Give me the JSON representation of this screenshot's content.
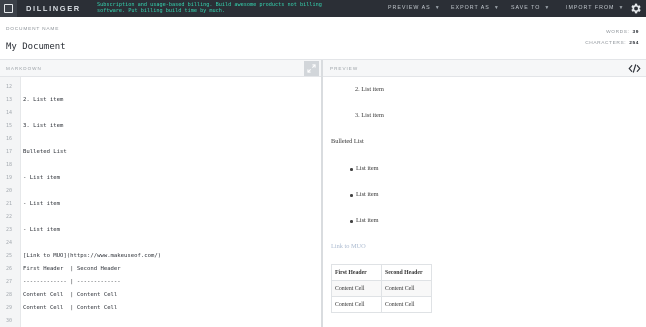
{
  "app": {
    "brand": "DILLINGER",
    "promo_line1": "Subscription and usage-based billing. Build awesome products not billing",
    "promo_line2": "software. Put billing build time by much.",
    "menu": [
      {
        "label": "PREVIEW AS"
      },
      {
        "label": "EXPORT AS"
      },
      {
        "label": "SAVE TO"
      },
      {
        "label": "IMPORT FROM"
      }
    ]
  },
  "document": {
    "name_label": "DOCUMENT NAME",
    "name": "My Document",
    "words_label": "WORDS:",
    "words": "39",
    "characters_label": "CHARACTERS:",
    "characters": "254"
  },
  "panes": {
    "editor_title": "MARKDOWN",
    "preview_title": "PREVIEW"
  },
  "editor_lines": [
    {
      "n": "12",
      "text": ""
    },
    {
      "n": "13",
      "text": "2. List item"
    },
    {
      "n": "14",
      "text": ""
    },
    {
      "n": "15",
      "text": "3. List item"
    },
    {
      "n": "16",
      "text": ""
    },
    {
      "n": "17",
      "text": "Bulleted List"
    },
    {
      "n": "18",
      "text": ""
    },
    {
      "n": "19",
      "text": "- List item"
    },
    {
      "n": "20",
      "text": ""
    },
    {
      "n": "21",
      "text": "- List item"
    },
    {
      "n": "22",
      "text": ""
    },
    {
      "n": "23",
      "text": "- List item"
    },
    {
      "n": "24",
      "text": ""
    },
    {
      "n": "25",
      "text": "[Link to MUO](https://www.makeuseof.com/)"
    },
    {
      "n": "26",
      "text": "First Header  | Second Header"
    },
    {
      "n": "27",
      "text": "------------- | -------------"
    },
    {
      "n": "28",
      "text": "Content Cell  | Content Cell"
    },
    {
      "n": "29",
      "text": "Content Cell  | Content Cell"
    },
    {
      "n": "30",
      "text": ""
    }
  ],
  "preview": {
    "ordered": [
      "2. List item",
      "3. List item"
    ],
    "heading": "Bulleted List",
    "bullets": [
      "List item",
      "List item",
      "List item"
    ],
    "link": "Link to MUO",
    "table": {
      "headers": [
        "First Header",
        "Second Header"
      ],
      "rows": [
        [
          "Content Cell",
          "Content Cell"
        ],
        [
          "Content Cell",
          "Content Cell"
        ]
      ]
    }
  },
  "icons": {
    "logo": "dillinger-logo-icon",
    "settings": "gear-icon",
    "expand": "expand-icon",
    "code": "code-icon"
  },
  "colors": {
    "topbar": "#2b2f36",
    "promo": "#35d6b1",
    "link": "#a9b9cf"
  }
}
